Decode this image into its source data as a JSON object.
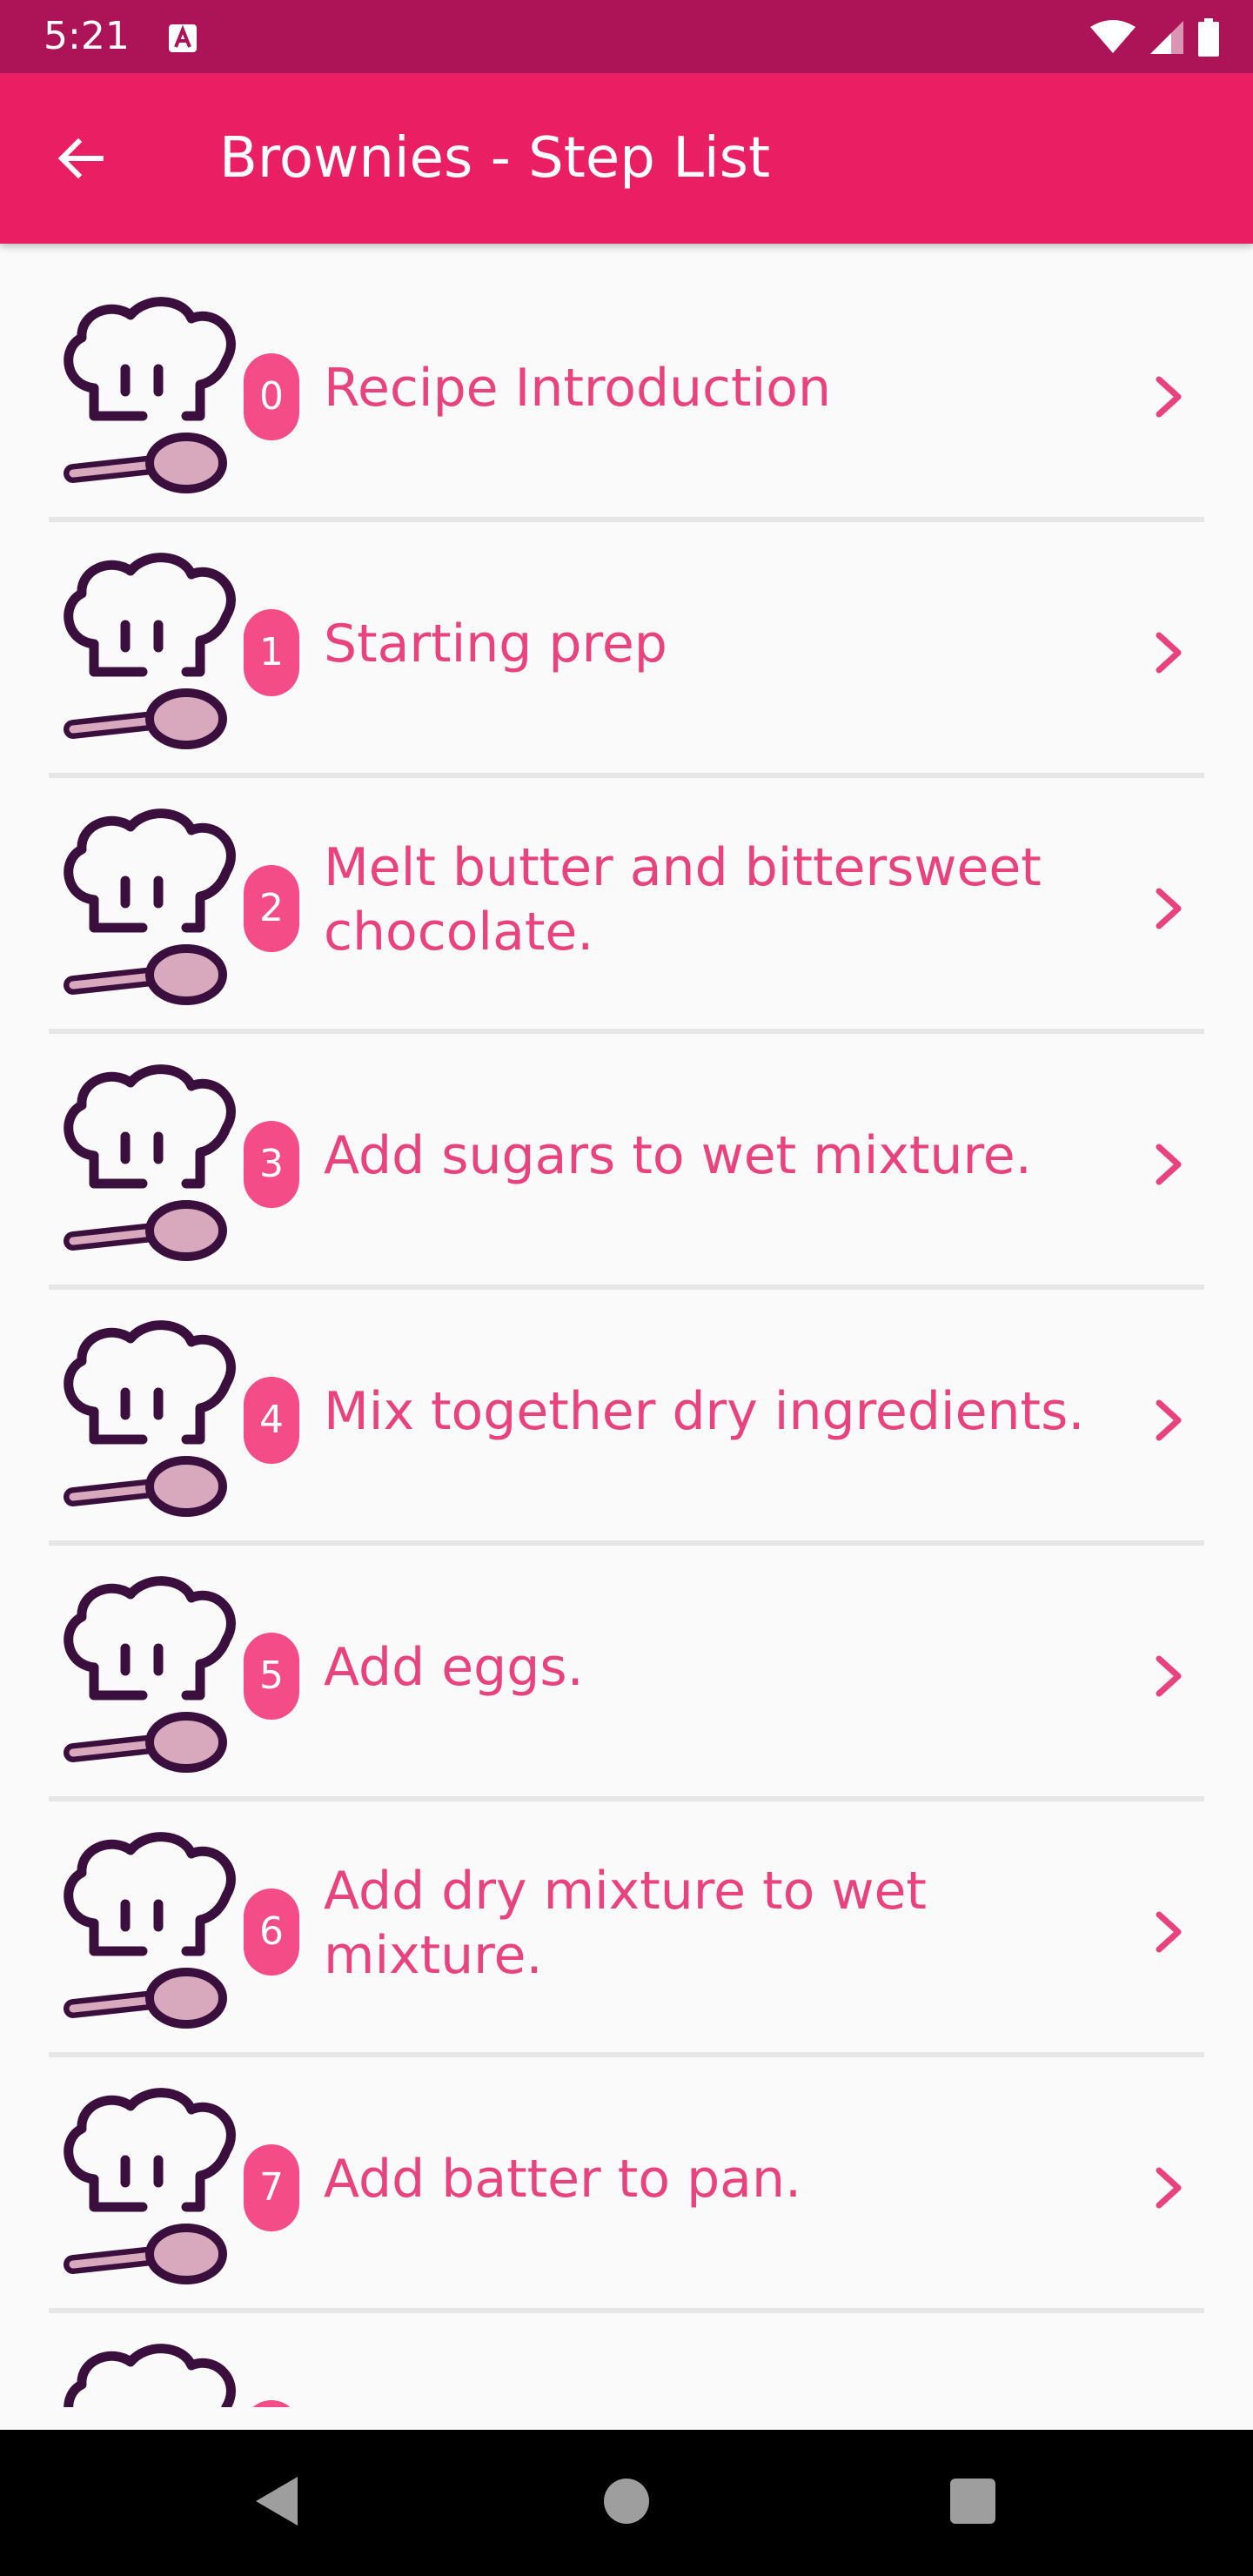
{
  "status_bar": {
    "time": "5:21",
    "icons": [
      "keyboard-a-icon",
      "wifi-icon",
      "signal-icon",
      "battery-icon"
    ],
    "background": "#ad1457"
  },
  "app_bar": {
    "title": "Brownies - Step List",
    "back_icon": "arrow-left-icon",
    "background": "#e91e63"
  },
  "colors": {
    "accent_text": "#e8437c",
    "badge": "#f44c86",
    "chef_outline": "#3a0f3e",
    "spoon_fill": "#d8a8bc"
  },
  "steps": [
    {
      "number": "0",
      "title": "Recipe Introduction"
    },
    {
      "number": "1",
      "title": "Starting prep"
    },
    {
      "number": "2",
      "title": "Melt butter and bittersweet chocolate."
    },
    {
      "number": "3",
      "title": "Add sugars to wet mixture."
    },
    {
      "number": "4",
      "title": "Mix together dry ingredients."
    },
    {
      "number": "5",
      "title": "Add eggs."
    },
    {
      "number": "6",
      "title": "Add dry mixture to wet mixture."
    },
    {
      "number": "7",
      "title": "Add batter to pan."
    }
  ],
  "navigation_bar": {
    "buttons": [
      "nav-back-icon",
      "nav-home-icon",
      "nav-recents-icon"
    ]
  }
}
